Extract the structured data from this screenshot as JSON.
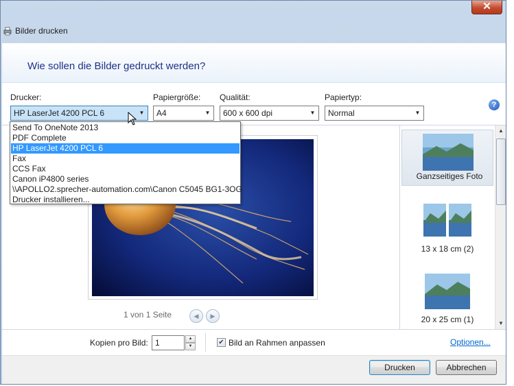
{
  "window": {
    "title": "Bilder drucken",
    "close_glyph": "✕",
    "icon": "printer-icon"
  },
  "header": {
    "heading": "Wie sollen die Bilder gedruckt werden?",
    "help_glyph": "?"
  },
  "fields": {
    "printer": {
      "label": "Drucker:",
      "value": "HP LaserJet 4200 PCL 6"
    },
    "paper_size": {
      "label": "Papiergröße:",
      "value": "A4"
    },
    "quality": {
      "label": "Qualität:",
      "value": "600 x 600 dpi"
    },
    "paper_type": {
      "label": "Papiertyp:",
      "value": "Normal"
    }
  },
  "printer_list": [
    "Send To OneNote 2013",
    "PDF Complete",
    "HP LaserJet 4200 PCL 6",
    "Fax",
    "CCS Fax",
    "Canon iP4800 series",
    "\\\\APOLLO2.sprecher-automation.com\\Canon C5045 BG1-3OG",
    "Drucker installieren..."
  ],
  "printer_list_selected_index": 2,
  "preview": {
    "page_indicator": "1 von 1 Seite",
    "prev_glyph": "◀",
    "next_glyph": "▶"
  },
  "layouts": [
    {
      "caption": "Ganzseitiges Foto"
    },
    {
      "caption": "13 x 18 cm (2)"
    },
    {
      "caption": "20 x 25 cm (1)"
    }
  ],
  "copies": {
    "label": "Kopien pro Bild:",
    "value": "1",
    "up_glyph": "▲",
    "down_glyph": "▼"
  },
  "fit_frame": {
    "label": "Bild an Rahmen anpassen",
    "checked": true,
    "check_glyph": "✔"
  },
  "options_link": "Optionen...",
  "buttons": {
    "print": "Drucken",
    "cancel": "Abbrechen"
  },
  "colors": {
    "accent": "#3399ff",
    "heading": "#1e3287",
    "link": "#0066cc"
  }
}
